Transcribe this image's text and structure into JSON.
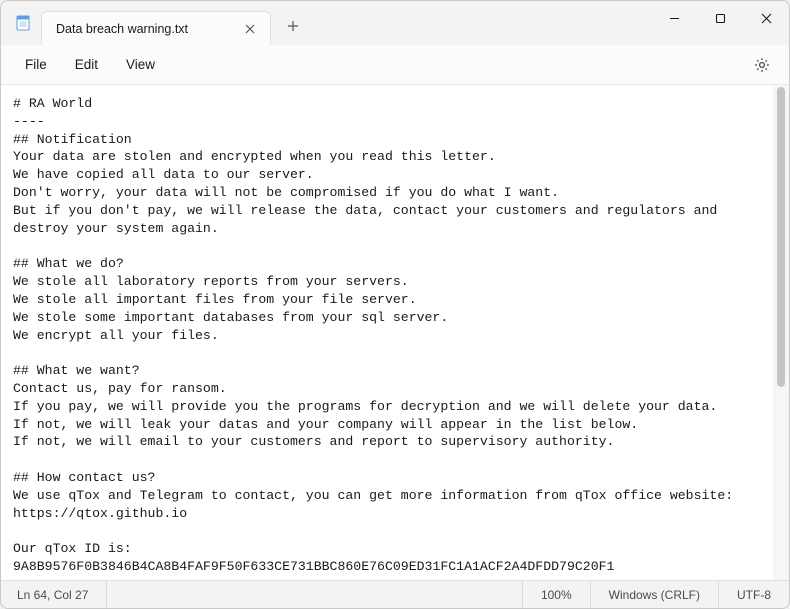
{
  "window": {
    "tab_title": "Data breach warning.txt"
  },
  "menu": {
    "file": "File",
    "edit": "Edit",
    "view": "View"
  },
  "document": {
    "text": "# RA World\n----\n## Notification\nYour data are stolen and encrypted when you read this letter.\nWe have copied all data to our server.\nDon't worry, your data will not be compromised if you do what I want.\nBut if you don't pay, we will release the data, contact your customers and regulators and\ndestroy your system again.\n\n## What we do?\nWe stole all laboratory reports from your servers.\nWe stole all important files from your file server.\nWe stole some important databases from your sql server.\nWe encrypt all your files.\n\n## What we want?\nContact us, pay for ransom.\nIf you pay, we will provide you the programs for decryption and we will delete your data.\nIf not, we will leak your datas and your company will appear in the list below.\nIf not, we will email to your customers and report to supervisory authority.\n\n## How contact us?\nWe use qTox and Telegram to contact, you can get more information from qTox office website:\nhttps://qtox.github.io\n\nOur qTox ID is:\n9A8B9576F0B3846B4CA8B4FAF9F50F633CE731BBC860E76C09ED31FC1A1ACF2A4DFDD79C20F1"
  },
  "status": {
    "position": "Ln 64, Col 27",
    "zoom": "100%",
    "line_ending": "Windows (CRLF)",
    "encoding": "UTF-8"
  }
}
